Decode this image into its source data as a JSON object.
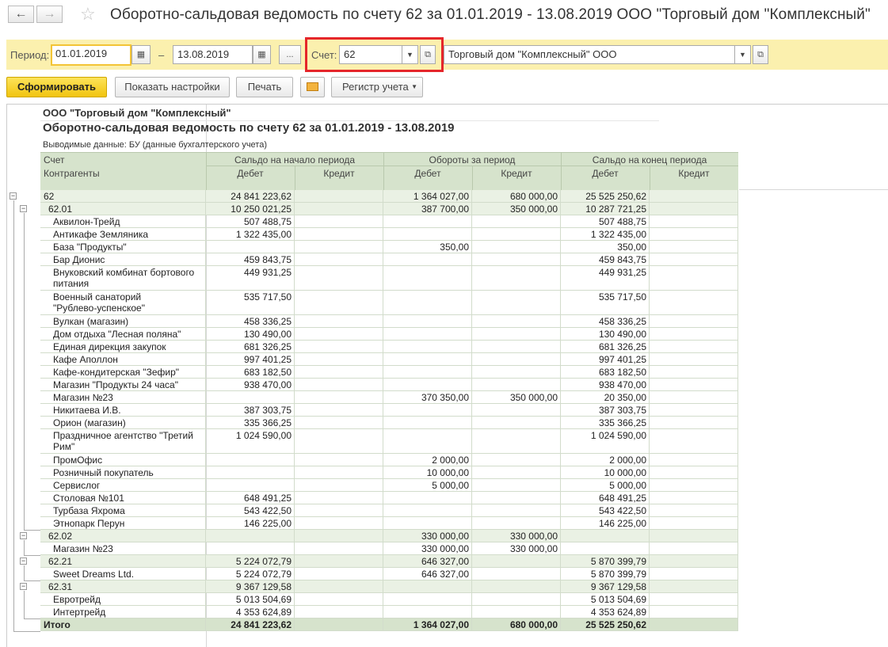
{
  "window": {
    "back_icon": "arrow-left-icon",
    "forward_icon": "arrow-right-icon",
    "star_icon": "star-icon",
    "title": "Оборотно-сальдовая ведомость по счету 62 за 01.01.2019 - 13.08.2019 ООО \"Торговый дом \"Комплексный\""
  },
  "filters": {
    "period_label": "Период:",
    "date_from": "01.01.2019",
    "dash": "–",
    "date_to": "13.08.2019",
    "more_label": "...",
    "account_label": "Счет:",
    "account_value": "62",
    "organization_value": "Торговый дом \"Комплексный\" ООО"
  },
  "toolbar": {
    "generate_label": "Сформировать",
    "settings_label": "Показать настройки",
    "print_label": "Печать",
    "email_icon": "envelope-icon",
    "register_label": "Регистр учета"
  },
  "report": {
    "org_name": "ООО \"Торговый дом \"Комплексный\"",
    "title": "Оборотно-сальдовая ведомость по счету 62 за 01.01.2019 - 13.08.2019",
    "output_data": "Выводимые данные:  БУ (данные бухгалтерского учета)",
    "headers": {
      "account": "Счет",
      "counterparties": "Контрагенты",
      "opening": "Сальдо на начало периода",
      "turnover": "Обороты за период",
      "closing": "Сальдо на конец периода",
      "debit": "Дебет",
      "credit": "Кредит"
    },
    "rows": [
      {
        "type": "g0",
        "name": "62",
        "od": "24 841 223,62",
        "oc": "",
        "td": "1 364 027,00",
        "tc": "680 000,00",
        "cd": "25 525 250,62",
        "cc": ""
      },
      {
        "type": "g1",
        "name": "62.01",
        "od": "10 250 021,25",
        "oc": "",
        "td": "387 700,00",
        "tc": "350 000,00",
        "cd": "10 287 721,25",
        "cc": ""
      },
      {
        "type": "i",
        "name": "Аквилон-Трейд",
        "od": "507 488,75",
        "oc": "",
        "td": "",
        "tc": "",
        "cd": "507 488,75",
        "cc": ""
      },
      {
        "type": "i",
        "name": "Антикафе Земляника",
        "od": "1 322 435,00",
        "oc": "",
        "td": "",
        "tc": "",
        "cd": "1 322 435,00",
        "cc": ""
      },
      {
        "type": "i",
        "name": "База \"Продукты\"",
        "od": "",
        "oc": "",
        "td": "350,00",
        "tc": "",
        "cd": "350,00",
        "cc": ""
      },
      {
        "type": "i",
        "name": "Бар Дионис",
        "od": "459 843,75",
        "oc": "",
        "td": "",
        "tc": "",
        "cd": "459 843,75",
        "cc": ""
      },
      {
        "type": "i2",
        "name": "Внуковский комбинат бортового",
        "name2": "питания",
        "od": "449 931,25",
        "oc": "",
        "td": "",
        "tc": "",
        "cd": "449 931,25",
        "cc": ""
      },
      {
        "type": "i2",
        "name": "Военный санаторий",
        "name2": "\"Рублево-успенское\"",
        "od": "535 717,50",
        "oc": "",
        "td": "",
        "tc": "",
        "cd": "535 717,50",
        "cc": ""
      },
      {
        "type": "i",
        "name": "Вулкан (магазин)",
        "od": "458 336,25",
        "oc": "",
        "td": "",
        "tc": "",
        "cd": "458 336,25",
        "cc": ""
      },
      {
        "type": "i",
        "name": "Дом отдыха \"Лесная поляна\"",
        "od": "130 490,00",
        "oc": "",
        "td": "",
        "tc": "",
        "cd": "130 490,00",
        "cc": ""
      },
      {
        "type": "i",
        "name": "Единая дирекция закупок",
        "od": "681 326,25",
        "oc": "",
        "td": "",
        "tc": "",
        "cd": "681 326,25",
        "cc": ""
      },
      {
        "type": "i",
        "name": "Кафе Аполлон",
        "od": "997 401,25",
        "oc": "",
        "td": "",
        "tc": "",
        "cd": "997 401,25",
        "cc": ""
      },
      {
        "type": "i",
        "name": "Кафе-кондитерская \"Зефир\"",
        "od": "683 182,50",
        "oc": "",
        "td": "",
        "tc": "",
        "cd": "683 182,50",
        "cc": ""
      },
      {
        "type": "i",
        "name": "Магазин \"Продукты 24 часа\"",
        "od": "938 470,00",
        "oc": "",
        "td": "",
        "tc": "",
        "cd": "938 470,00",
        "cc": ""
      },
      {
        "type": "i",
        "name": "Магазин №23",
        "od": "",
        "oc": "",
        "td": "370 350,00",
        "tc": "350 000,00",
        "cd": "20 350,00",
        "cc": ""
      },
      {
        "type": "i",
        "name": "Никитаева И.В.",
        "od": "387 303,75",
        "oc": "",
        "td": "",
        "tc": "",
        "cd": "387 303,75",
        "cc": ""
      },
      {
        "type": "i",
        "name": "Орион (магазин)",
        "od": "335 366,25",
        "oc": "",
        "td": "",
        "tc": "",
        "cd": "335 366,25",
        "cc": ""
      },
      {
        "type": "i2",
        "name": "Праздничное агентство \"Третий",
        "name2": "Рим\"",
        "od": "1 024 590,00",
        "oc": "",
        "td": "",
        "tc": "",
        "cd": "1 024 590,00",
        "cc": ""
      },
      {
        "type": "i",
        "name": "ПромОфис",
        "od": "",
        "oc": "",
        "td": "2 000,00",
        "tc": "",
        "cd": "2 000,00",
        "cc": ""
      },
      {
        "type": "i",
        "name": "Розничный покупатель",
        "od": "",
        "oc": "",
        "td": "10 000,00",
        "tc": "",
        "cd": "10 000,00",
        "cc": ""
      },
      {
        "type": "i",
        "name": "Сервислог",
        "od": "",
        "oc": "",
        "td": "5 000,00",
        "tc": "",
        "cd": "5 000,00",
        "cc": ""
      },
      {
        "type": "i",
        "name": "Столовая №101",
        "od": "648 491,25",
        "oc": "",
        "td": "",
        "tc": "",
        "cd": "648 491,25",
        "cc": ""
      },
      {
        "type": "i",
        "name": "Турбаза Яхрома",
        "od": "543 422,50",
        "oc": "",
        "td": "",
        "tc": "",
        "cd": "543 422,50",
        "cc": ""
      },
      {
        "type": "i",
        "name": "Этнопарк Перун",
        "od": "146 225,00",
        "oc": "",
        "td": "",
        "tc": "",
        "cd": "146 225,00",
        "cc": ""
      },
      {
        "type": "g1",
        "name": "62.02",
        "od": "",
        "oc": "",
        "td": "330 000,00",
        "tc": "330 000,00",
        "cd": "",
        "cc": ""
      },
      {
        "type": "i",
        "name": "Магазин №23",
        "od": "",
        "oc": "",
        "td": "330 000,00",
        "tc": "330 000,00",
        "cd": "",
        "cc": ""
      },
      {
        "type": "g1",
        "name": "62.21",
        "od": "5 224 072,79",
        "oc": "",
        "td": "646 327,00",
        "tc": "",
        "cd": "5 870 399,79",
        "cc": ""
      },
      {
        "type": "i",
        "name": "Sweet Dreams Ltd.",
        "od": "5 224 072,79",
        "oc": "",
        "td": "646 327,00",
        "tc": "",
        "cd": "5 870 399,79",
        "cc": ""
      },
      {
        "type": "g1",
        "name": "62.31",
        "od": "9 367 129,58",
        "oc": "",
        "td": "",
        "tc": "",
        "cd": "9 367 129,58",
        "cc": ""
      },
      {
        "type": "i",
        "name": "Евротрейд",
        "od": "5 013 504,69",
        "oc": "",
        "td": "",
        "tc": "",
        "cd": "5 013 504,69",
        "cc": ""
      },
      {
        "type": "i",
        "name": "Интертрейд",
        "od": "4 353 624,89",
        "oc": "",
        "td": "",
        "tc": "",
        "cd": "4 353 624,89",
        "cc": ""
      }
    ],
    "total": {
      "name": "Итого",
      "od": "24 841 223,62",
      "oc": "",
      "td": "1 364 027,00",
      "tc": "680 000,00",
      "cd": "25 525 250,62",
      "cc": ""
    },
    "toggle_symbol": "−"
  }
}
